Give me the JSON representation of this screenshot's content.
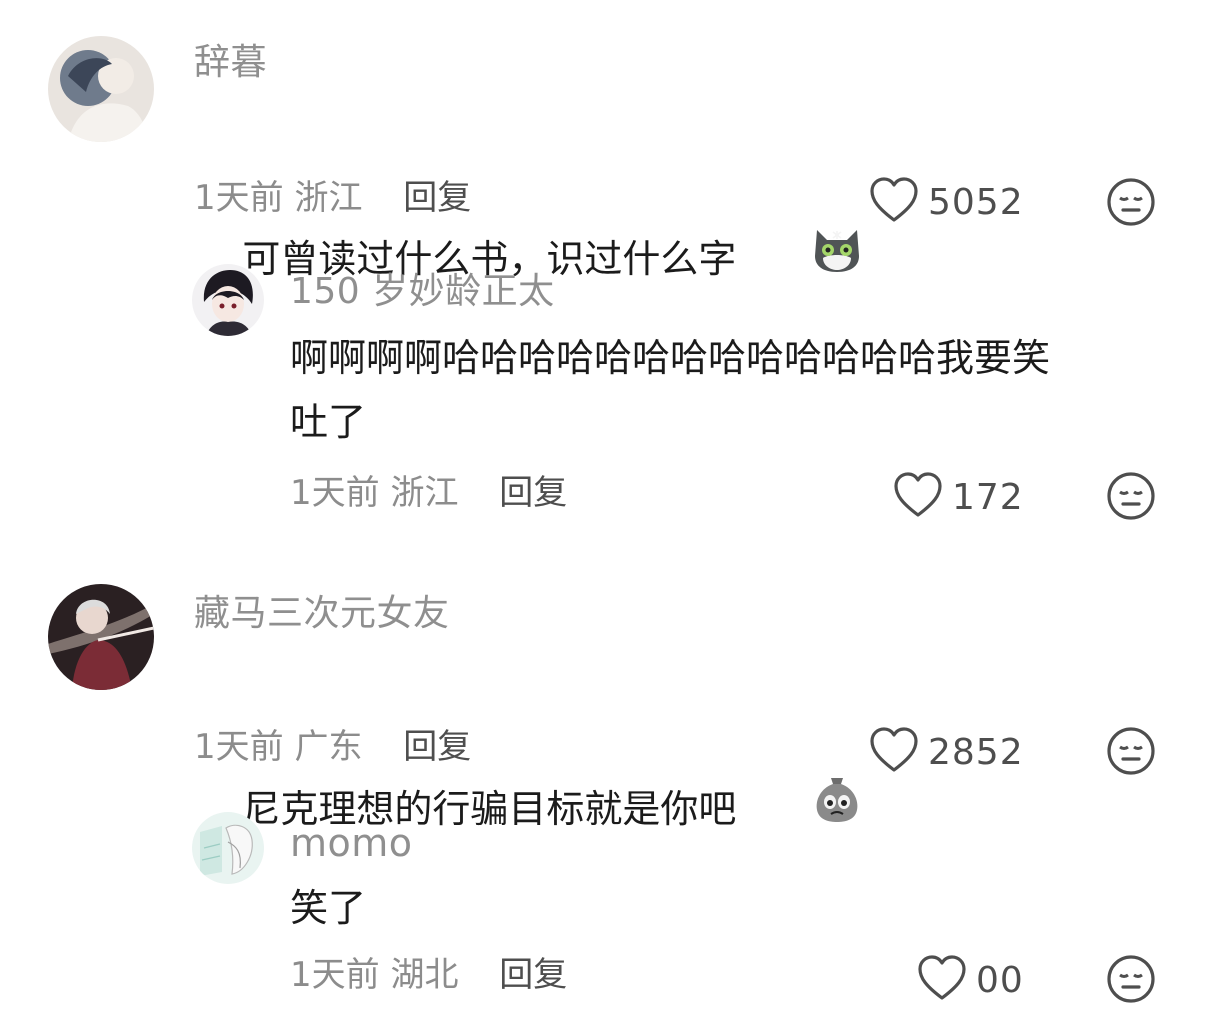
{
  "comments": [
    {
      "username": "辞暮",
      "text": "可曾读过什么书，识过什么字",
      "emoji": "cat-emoji",
      "time": "1天前",
      "location": "浙江",
      "reply_label": "回复",
      "likes": "5052"
    },
    {
      "username": "150 岁妙龄正太",
      "text": "啊啊啊啊哈哈哈哈哈哈哈哈哈哈哈哈哈我要笑\n吐了",
      "time": "1天前",
      "location": "浙江",
      "reply_label": "回复",
      "likes": "172"
    },
    {
      "username": "藏马三次元女友",
      "text": "尼克理想的行骗目标就是你吧",
      "emoji": "sad-bag-emoji",
      "time": "1天前",
      "location": "广东",
      "reply_label": "回复",
      "likes": "2852"
    },
    {
      "username": "momo",
      "text": "笑了",
      "time": "1天前",
      "location": "湖北",
      "reply_label": "回复",
      "likes": "00"
    }
  ],
  "colors": {
    "username": "#8f8f8f",
    "meta": "#8c8c8c",
    "action": "#4e4e4e"
  }
}
